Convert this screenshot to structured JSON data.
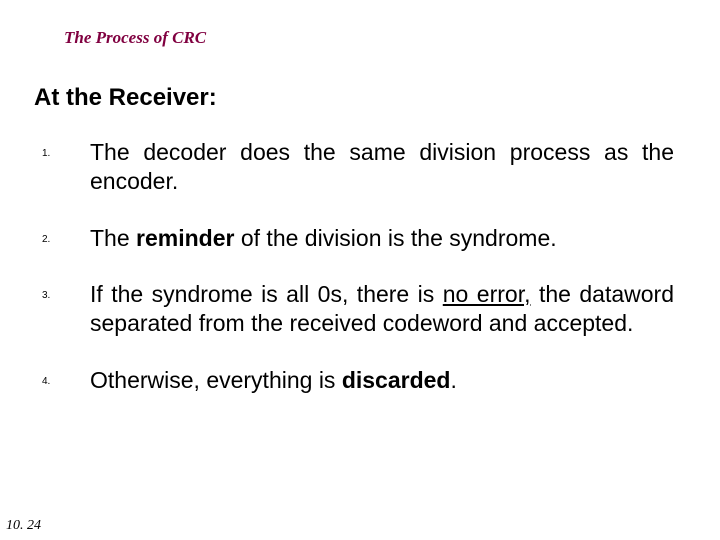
{
  "title": "The Process of CRC",
  "subtitle": "At the Receiver:",
  "items": [
    {
      "num": "1.",
      "parts": [
        {
          "t": "The decoder does the same division process as the encoder."
        }
      ]
    },
    {
      "num": "2.",
      "parts": [
        {
          "t": "The "
        },
        {
          "t": "reminder",
          "bold": true
        },
        {
          "t": " of the division is the syndrome."
        }
      ]
    },
    {
      "num": "3.",
      "parts": [
        {
          "t": "If the syndrome is all 0s, there is "
        },
        {
          "t": "no error,",
          "underline": true
        },
        {
          "t": " the dataword separated from the received codeword and accepted."
        }
      ]
    },
    {
      "num": "4.",
      "parts": [
        {
          "t": "Otherwise, everything is "
        },
        {
          "t": "discarded",
          "bold": true
        },
        {
          "t": "."
        }
      ]
    }
  ],
  "page_number": "10. 24"
}
